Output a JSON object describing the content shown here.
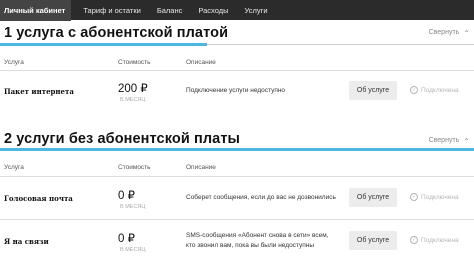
{
  "nav": {
    "tabs": [
      "Личный кабинет",
      "Тариф и остатки",
      "Баланс",
      "Расходы",
      "Услуги"
    ],
    "active_index": 0
  },
  "sections": [
    {
      "title": "1 услуга с абонентской платой",
      "collapse_label": "Свернуть",
      "columns": {
        "service": "Услуга",
        "cost": "Стоимость",
        "description": "Описание"
      },
      "rows": [
        {
          "name": "Пакет интернета",
          "price": "200 ₽",
          "price_period": "В МЕСЯЦ",
          "description": [
            "Подключение услуги недоступно"
          ],
          "about_label": "Об услуге",
          "connect_label": "Подключена"
        }
      ]
    },
    {
      "title": "2 услуги без абонентской платы",
      "collapse_label": "Свернуть",
      "columns": {
        "service": "Услуга",
        "cost": "Стоимость",
        "description": "Описание"
      },
      "rows": [
        {
          "name": "Голосовая почта",
          "price": "0 ₽",
          "price_period": "В МЕСЯЦ",
          "description": [
            "Соберет сообщения, если до вас не дозвонились"
          ],
          "about_label": "Об услуге",
          "connect_label": "Подключена"
        },
        {
          "name": "Я на связи",
          "price": "0 ₽",
          "price_period": "В МЕСЯЦ",
          "description": [
            "SMS-сообщения «Абонент снова в сети» всем,",
            "кто звонил вам, пока вы были недоступны"
          ],
          "about_label": "Об услуге",
          "connect_label": "Подключена"
        }
      ]
    }
  ],
  "colors": {
    "accent": "#4cb8e0",
    "nav_bg": "#2b2b2b"
  },
  "icons": {
    "collapse": "chevron-up-icon",
    "connected": "check-circle-icon"
  }
}
